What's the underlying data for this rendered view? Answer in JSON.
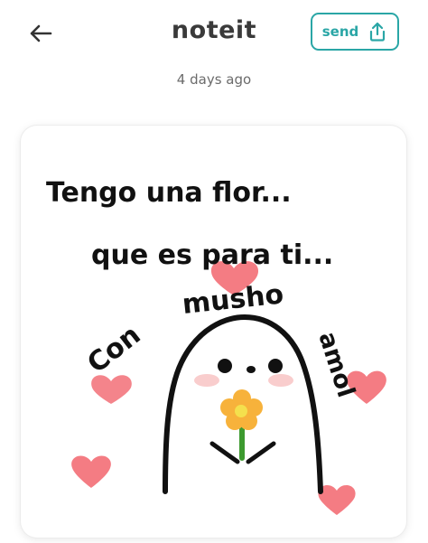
{
  "header": {
    "back_icon": "arrow-left-icon",
    "title": "noteit",
    "send_label": "send",
    "send_icon": "share-upload-icon",
    "accent": "#2aa6a6"
  },
  "note": {
    "timestamp": "4 days ago",
    "line1": "Tengo una flor...",
    "line2": "que es para ti...",
    "line3_a": "Con",
    "line3_b": "musho",
    "line3_c": "amol",
    "heart_color": "#f0505a",
    "flower_color": "#f7b23b"
  }
}
